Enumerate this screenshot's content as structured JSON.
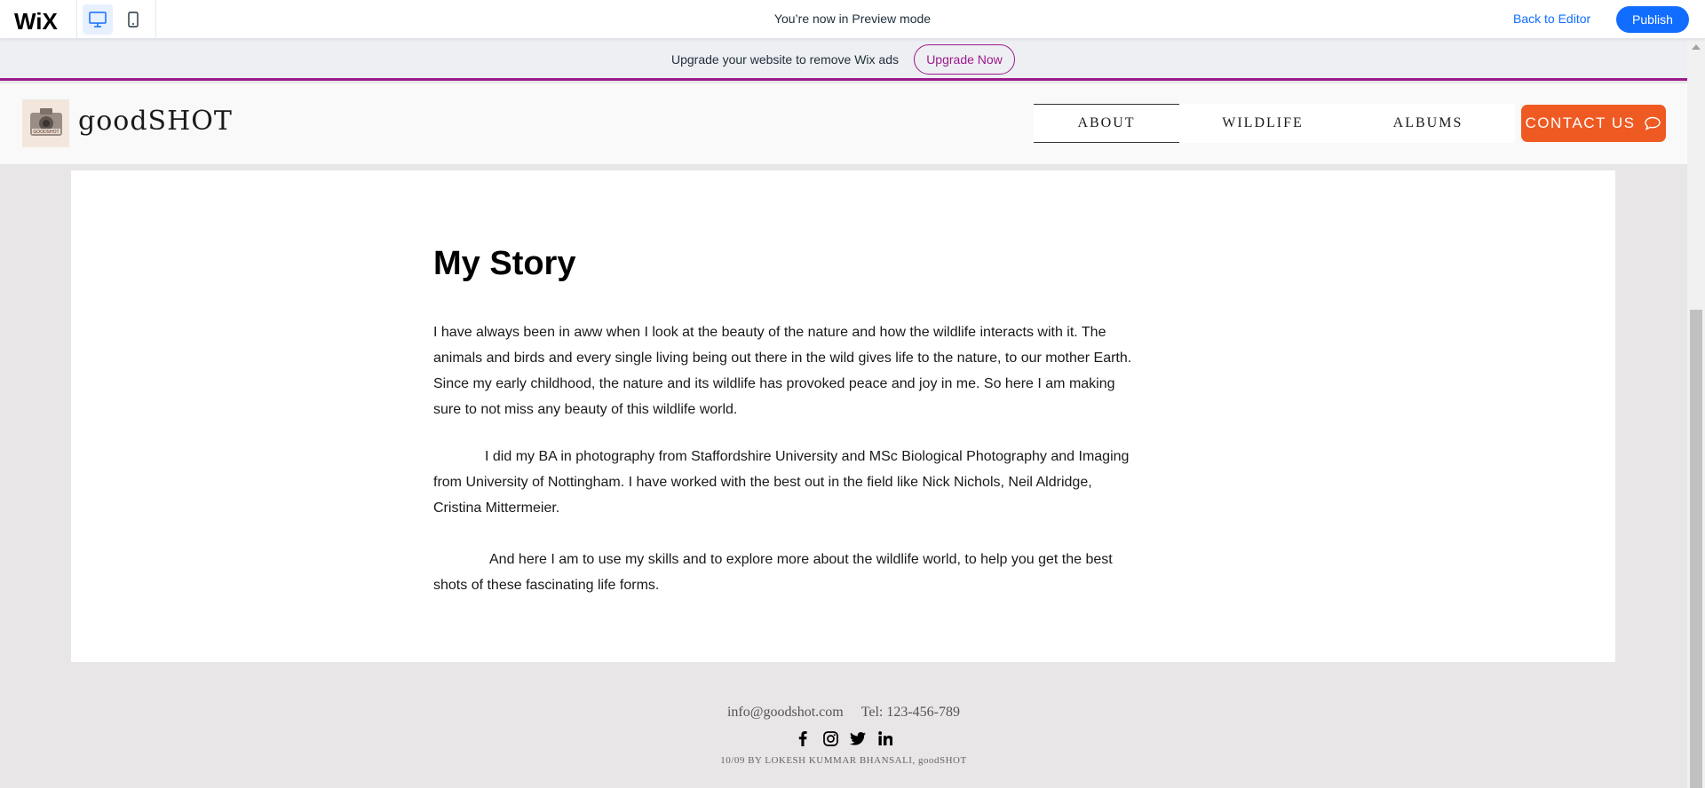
{
  "wix_bar": {
    "logo": "WiX",
    "preview_text": "You’re now in Preview mode",
    "back_label": "Back to Editor",
    "publish_label": "Publish"
  },
  "ad_strip": {
    "text": "Upgrade your website to remove Wix ads",
    "button_label": "Upgrade Now"
  },
  "site_header": {
    "brand_name": "goodSHOT",
    "logo_text": "GOODSHOT",
    "nav": [
      {
        "label": "ABOUT",
        "active": true
      },
      {
        "label": "WILDLIFE",
        "active": false
      },
      {
        "label": "ALBUMS",
        "active": false
      }
    ],
    "contact_label": "CONTACT US"
  },
  "main": {
    "title": "My Story",
    "paragraphs": [
      "I have always been in aww when I look at the beauty of the nature and how the wildlife interacts with it. The animals and birds and every single living being out there in the wild gives life to the nature, to our mother Earth. Since my early childhood, the nature and its wildlife has provoked peace and joy in me. So here I am making sure to not miss any beauty of this wildlife world.",
      "I did my BA in photography from Staffordshire University and MSc Biological Photography and Imaging from University of Nottingham. I have worked with the best out in the field like Nick Nichols, Neil Aldridge, Cristina Mittermeier.",
      "And here I am to use my skills and to explore more about the wildlife world, to help you get the best shots of these fascinating life forms."
    ]
  },
  "footer": {
    "email": "info@goodshot.com",
    "tel": "Tel: 123-456-789",
    "social": [
      "facebook-icon",
      "instagram-icon",
      "twitter-icon",
      "linkedin-icon"
    ],
    "copyright": "10/09 BY LOKESH KUMMAR BHANSALI, goodSHOT"
  },
  "colors": {
    "accent": "#ef5a23",
    "wix_blue": "#116dff",
    "upgrade_purple": "#9c1a8c"
  }
}
